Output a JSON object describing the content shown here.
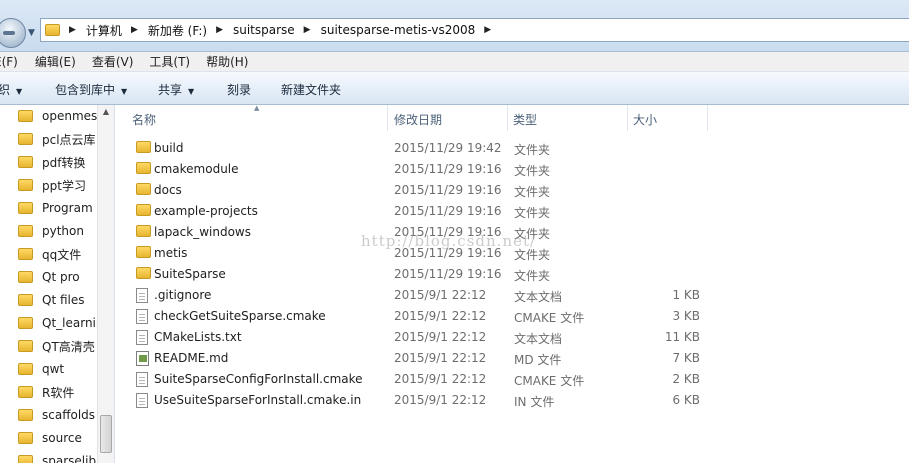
{
  "address": {
    "crumbs": [
      "计算机",
      "新加卷 (F:)",
      "suitsparse",
      "suitesparse-metis-vs2008"
    ]
  },
  "menu": [
    "E(F)",
    "编辑(E)",
    "查看(V)",
    "工具(T)",
    "帮助(H)"
  ],
  "toolbar": {
    "organize": "织",
    "include_library": "包含到库中",
    "share": "共享",
    "burn": "刻录",
    "new_folder": "新建文件夹"
  },
  "nav": {
    "items": [
      "openmesl",
      "pcl点云库",
      "pdf转换",
      "ppt学习",
      "Program",
      "python",
      "qq文件",
      "Qt  pro",
      "Qt files",
      "Qt_learnir",
      "QT高清壳",
      "qwt",
      "R软件",
      "scaffolds",
      "source",
      "sparselib"
    ]
  },
  "columns": {
    "name": "名称",
    "date": "修改日期",
    "type": "类型",
    "size": "大小"
  },
  "files": [
    {
      "name": "build",
      "date": "2015/11/29 19:42",
      "type": "文件夹",
      "size": "",
      "icon": "folder-icon"
    },
    {
      "name": "cmakemodule",
      "date": "2015/11/29 19:16",
      "type": "文件夹",
      "size": "",
      "icon": "folder-icon"
    },
    {
      "name": "docs",
      "date": "2015/11/29 19:16",
      "type": "文件夹",
      "size": "",
      "icon": "folder-icon"
    },
    {
      "name": "example-projects",
      "date": "2015/11/29 19:16",
      "type": "文件夹",
      "size": "",
      "icon": "folder-icon"
    },
    {
      "name": "lapack_windows",
      "date": "2015/11/29 19:16",
      "type": "文件夹",
      "size": "",
      "icon": "folder-icon"
    },
    {
      "name": "metis",
      "date": "2015/11/29 19:16",
      "type": "文件夹",
      "size": "",
      "icon": "folder-icon"
    },
    {
      "name": "SuiteSparse",
      "date": "2015/11/29 19:16",
      "type": "文件夹",
      "size": "",
      "icon": "folder-icon"
    },
    {
      "name": ".gitignore",
      "date": "2015/9/1 22:12",
      "type": "文本文档",
      "size": "1 KB",
      "icon": "text-file-icon"
    },
    {
      "name": "checkGetSuiteSparse.cmake",
      "date": "2015/9/1 22:12",
      "type": "CMAKE 文件",
      "size": "3 KB",
      "icon": "file-icon"
    },
    {
      "name": "CMakeLists.txt",
      "date": "2015/9/1 22:12",
      "type": "文本文档",
      "size": "11 KB",
      "icon": "text-file-icon"
    },
    {
      "name": "README.md",
      "date": "2015/9/1 22:12",
      "type": "MD 文件",
      "size": "7 KB",
      "icon": "md-file-icon"
    },
    {
      "name": "SuiteSparseConfigForInstall.cmake",
      "date": "2015/9/1 22:12",
      "type": "CMAKE 文件",
      "size": "2 KB",
      "icon": "file-icon"
    },
    {
      "name": "UseSuiteSparseForInstall.cmake.in",
      "date": "2015/9/1 22:12",
      "type": "IN 文件",
      "size": "6 KB",
      "icon": "file-icon"
    }
  ],
  "watermark": "http://blog.csdn.net/"
}
